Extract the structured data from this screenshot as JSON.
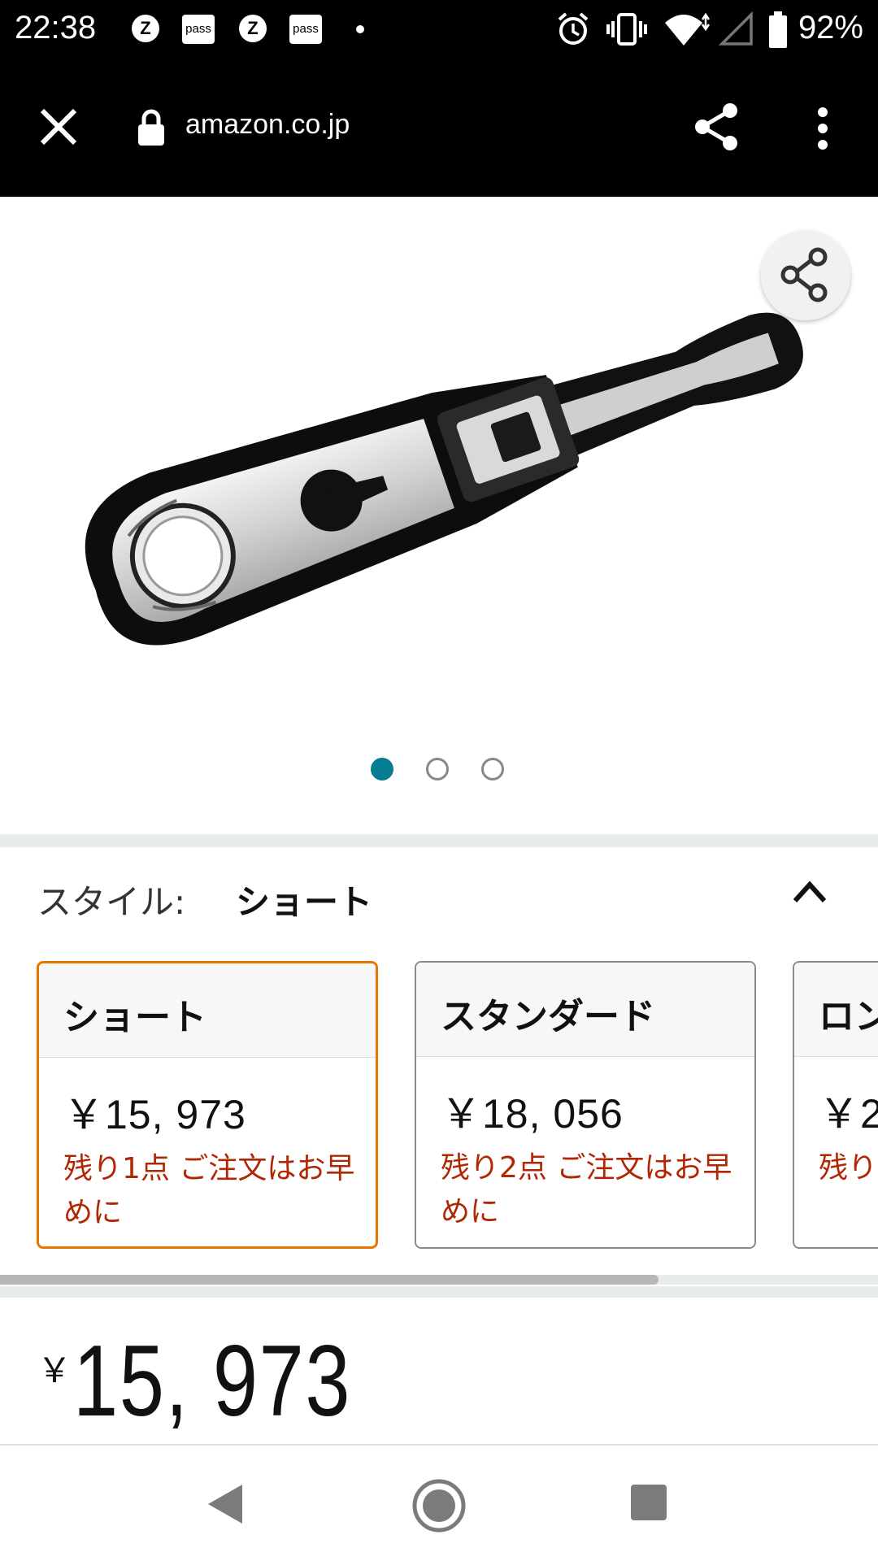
{
  "status_bar": {
    "time": "22:38",
    "notifications": [
      "z-app-icon",
      "pass-app-icon",
      "z-app-icon",
      "pass-app-icon",
      "more-dot"
    ],
    "z_label": "Z",
    "pass_label": "pass",
    "system_icons": [
      "alarm-icon",
      "vibrate-icon",
      "wifi-icon",
      "signal-icon",
      "battery-icon"
    ],
    "battery": "92%"
  },
  "browser": {
    "url": "amazon.co.jp",
    "close_icon": "close-icon",
    "lock_icon": "lock-icon",
    "share_icon": "share-icon",
    "menu_icon": "more-vert-icon"
  },
  "product": {
    "image_name": "ratchet-wrench-image",
    "image_count": 3,
    "active_image_index": 0
  },
  "style": {
    "label": "スタイル:",
    "selected_value": "ショート"
  },
  "options": [
    {
      "name": "ショート",
      "price": "￥15, 973",
      "stock": "残り1点 ご注文はお早めに",
      "selected": true
    },
    {
      "name": "スタンダード",
      "price": "￥18, 056",
      "stock": "残り2点 ご注文はお早めに",
      "selected": false
    },
    {
      "name": "ロン",
      "price": "￥2",
      "stock": "残り",
      "selected": false
    }
  ],
  "price": {
    "symbol": "￥",
    "value": "15, 973"
  },
  "colors": {
    "accent_teal": "#067d92",
    "selected_border": "#e77600",
    "stock_red": "#b12704"
  },
  "nav": {
    "icons": [
      "back-icon",
      "home-icon",
      "recents-icon"
    ]
  }
}
